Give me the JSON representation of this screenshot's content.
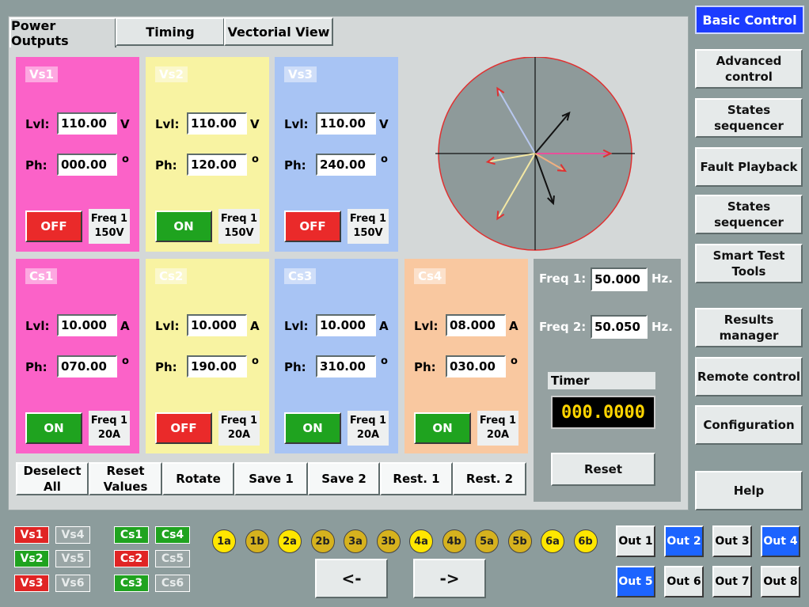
{
  "tabs": [
    {
      "label": "Power Outputs",
      "active": true
    },
    {
      "label": "Timing",
      "active": false
    },
    {
      "label": "Vectorial View",
      "active": false
    }
  ],
  "voltage_sources": [
    {
      "name": "Vs1",
      "lvl_label": "Lvl:",
      "lvl": "110.00",
      "lvl_unit": "V",
      "ph_label": "Ph:",
      "ph": "000.00",
      "ph_unit": "o",
      "state": "OFF",
      "freq_line1": "Freq 1",
      "freq_line2": "150V",
      "color": "#fb62c8"
    },
    {
      "name": "Vs2",
      "lvl_label": "Lvl:",
      "lvl": "110.00",
      "lvl_unit": "V",
      "ph_label": "Ph:",
      "ph": "120.00",
      "ph_unit": "o",
      "state": "ON",
      "freq_line1": "Freq 1",
      "freq_line2": "150V",
      "color": "#f8f3a2"
    },
    {
      "name": "Vs3",
      "lvl_label": "Lvl:",
      "lvl": "110.00",
      "lvl_unit": "V",
      "ph_label": "Ph:",
      "ph": "240.00",
      "ph_unit": "o",
      "state": "OFF",
      "freq_line1": "Freq 1",
      "freq_line2": "150V",
      "color": "#a8c4f4"
    }
  ],
  "current_sources": [
    {
      "name": "Cs1",
      "lvl_label": "Lvl:",
      "lvl": "10.000",
      "lvl_unit": "A",
      "ph_label": "Ph:",
      "ph": "070.00",
      "ph_unit": "o",
      "state": "ON",
      "freq_line1": "Freq 1",
      "freq_line2": "20A",
      "color": "#fb62c8"
    },
    {
      "name": "Cs2",
      "lvl_label": "Lvl:",
      "lvl": "10.000",
      "lvl_unit": "A",
      "ph_label": "Ph:",
      "ph": "190.00",
      "ph_unit": "o",
      "state": "OFF",
      "freq_line1": "Freq 1",
      "freq_line2": "20A",
      "color": "#f8f3a2"
    },
    {
      "name": "Cs3",
      "lvl_label": "Lvl:",
      "lvl": "10.000",
      "lvl_unit": "A",
      "ph_label": "Ph:",
      "ph": "310.00",
      "ph_unit": "o",
      "state": "ON",
      "freq_line1": "Freq 1",
      "freq_line2": "20A",
      "color": "#a8c4f4"
    },
    {
      "name": "Cs4",
      "lvl_label": "Lvl:",
      "lvl": "08.000",
      "lvl_unit": "A",
      "ph_label": "Ph:",
      "ph": "030.00",
      "ph_unit": "o",
      "state": "ON",
      "freq_line1": "Freq 1",
      "freq_line2": "20A",
      "color": "#f9c8a0"
    }
  ],
  "vectors": [
    {
      "angle_deg": 0,
      "magnitude": 0.78,
      "color": "#e8509a"
    },
    {
      "angle_deg": 120,
      "magnitude": 0.78,
      "color": "#b8c8f0"
    },
    {
      "angle_deg": 240,
      "magnitude": 0.78,
      "color": "#f4e8a4"
    },
    {
      "angle_deg": -70,
      "magnitude": 0.55,
      "color": "#111111"
    },
    {
      "angle_deg": 190,
      "magnitude": 0.5,
      "color": "#f4e8a4"
    },
    {
      "angle_deg": 50,
      "magnitude": 0.55,
      "color": "#111111"
    },
    {
      "angle_deg": -30,
      "magnitude": 0.36,
      "color": "#f0b080"
    }
  ],
  "freq_panel": {
    "freq1_label": "Freq 1:",
    "freq1_value": "50.000",
    "freq1_unit": "Hz.",
    "freq2_label": "Freq 2:",
    "freq2_value": "50.050",
    "freq2_unit": "Hz.",
    "timer_label": "Timer",
    "timer_value": "000.0000",
    "reset_label": "Reset"
  },
  "bottom_buttons": [
    "Deselect All",
    "Reset Values",
    "Rotate",
    "Save 1",
    "Save 2",
    "Rest. 1",
    "Rest. 2"
  ],
  "sidebar": {
    "basic_control": "Basic Control",
    "items": [
      "Advanced control",
      "States sequencer",
      "Fault Playback",
      "States sequencer",
      "Smart Test Tools",
      "Results manager",
      "Remote control",
      "Configuration",
      "Help"
    ]
  },
  "channel_indicators": [
    {
      "label": "Vs1",
      "state": "red"
    },
    {
      "label": "Vs4",
      "state": "grey"
    },
    {
      "label": "Vs2",
      "state": "green"
    },
    {
      "label": "Vs5",
      "state": "grey"
    },
    {
      "label": "Vs3",
      "state": "red"
    },
    {
      "label": "Vs6",
      "state": "grey"
    },
    {
      "label": "Cs1",
      "state": "green"
    },
    {
      "label": "Cs4",
      "state": "green"
    },
    {
      "label": "Cs2",
      "state": "red"
    },
    {
      "label": "Cs5",
      "state": "grey"
    },
    {
      "label": "Cs3",
      "state": "green"
    },
    {
      "label": "Cs6",
      "state": "grey"
    }
  ],
  "steps": [
    {
      "label": "1a",
      "style": "yellow"
    },
    {
      "label": "1b",
      "style": "olive"
    },
    {
      "label": "2a",
      "style": "yellow"
    },
    {
      "label": "2b",
      "style": "olive"
    },
    {
      "label": "3a",
      "style": "olive"
    },
    {
      "label": "3b",
      "style": "olive"
    },
    {
      "label": "4a",
      "style": "yellow"
    },
    {
      "label": "4b",
      "style": "olive"
    },
    {
      "label": "5a",
      "style": "olive"
    },
    {
      "label": "5b",
      "style": "olive"
    },
    {
      "label": "6a",
      "style": "yellow"
    },
    {
      "label": "6b",
      "style": "yellow"
    }
  ],
  "nav": {
    "prev": "<-",
    "next": "->"
  },
  "outputs": [
    {
      "label": "Out 1",
      "active": false
    },
    {
      "label": "Out 2",
      "active": true
    },
    {
      "label": "Out 3",
      "active": false
    },
    {
      "label": "Out 4",
      "active": true
    },
    {
      "label": "Out 5",
      "active": true
    },
    {
      "label": "Out 6",
      "active": false
    },
    {
      "label": "Out 7",
      "active": false
    },
    {
      "label": "Out 8",
      "active": false
    }
  ]
}
